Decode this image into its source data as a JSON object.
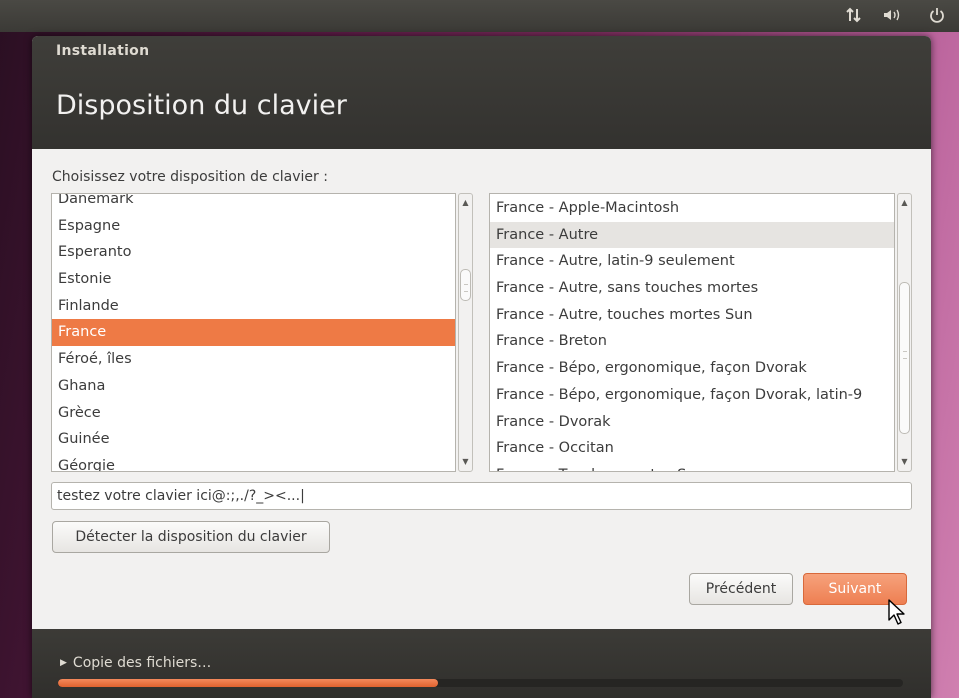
{
  "top_panel": {
    "network_icon": "network-arrows-icon",
    "sound_icon": "speaker-icon",
    "power_icon": "power-icon"
  },
  "window": {
    "title": "Installation",
    "page_title": "Disposition du clavier"
  },
  "prompt": "Choisissez votre disposition de clavier :",
  "layouts": {
    "items": [
      "Danemark",
      "Espagne",
      "Esperanto",
      "Estonie",
      "Finlande",
      "France",
      "Féroé, îles",
      "Ghana",
      "Grèce",
      "Guinée",
      "Géorgie"
    ],
    "selected": "France"
  },
  "variants": {
    "items": [
      "France - Apple-Macintosh",
      "France - Autre",
      "France - Autre, latin-9 seulement",
      "France - Autre, sans touches mortes",
      "France - Autre, touches mortes Sun",
      "France - Breton",
      "France - Bépo, ergonomique, façon Dvorak",
      "France - Bépo, ergonomique, façon Dvorak, latin-9",
      "France - Dvorak",
      "France - Occitan",
      "France - Touches mortes Sun"
    ],
    "highlighted": "France - Autre"
  },
  "test_input": {
    "value": "testez votre clavier ici@:;,./?_><...|"
  },
  "buttons": {
    "detect": "Détecter la disposition du clavier",
    "previous": "Précédent",
    "next": "Suivant"
  },
  "progress": {
    "label": "Copie des fichiers…",
    "fraction": 0.45
  },
  "colors": {
    "accent": "#ee7a45",
    "header": "#3c3b37"
  }
}
